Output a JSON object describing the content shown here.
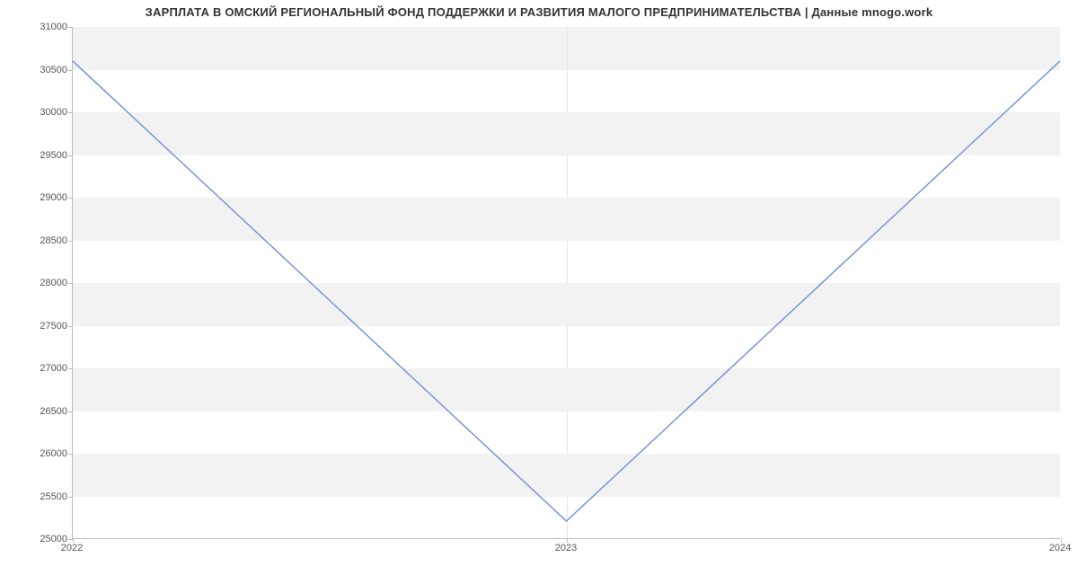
{
  "chart_data": {
    "type": "line",
    "title": "ЗАРПЛАТА В ОМСКИЙ РЕГИОНАЛЬНЫЙ ФОНД ПОДДЕРЖКИ И РАЗВИТИЯ МАЛОГО ПРЕДПРИНИМАТЕЛЬСТВА | Данные mnogo.work",
    "xlabel": "",
    "ylabel": "",
    "x_ticks": [
      "2022",
      "2023",
      "2024"
    ],
    "y_ticks": [
      25000,
      25500,
      26000,
      26500,
      27000,
      27500,
      28000,
      28500,
      29000,
      29500,
      30000,
      30500,
      31000
    ],
    "ylim": [
      25000,
      31000
    ],
    "x": [
      2022,
      2023,
      2024
    ],
    "values": [
      30600,
      25200,
      30600
    ],
    "line_color": "#6f8dd9",
    "band_color": "#f2f2f2"
  }
}
